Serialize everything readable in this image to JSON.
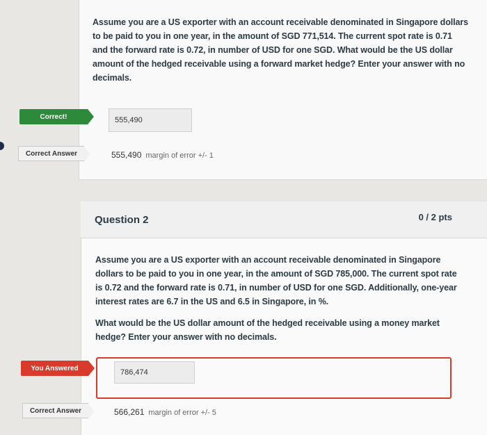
{
  "question1": {
    "text": "Assume you are a US exporter with an account receivable denominated in Singapore dollars to be paid to you in one year, in the amount of SGD 771,514. The current spot rate is 0.71 and the forward rate is 0.72, in number of USD for one SGD. What would be the US dollar amount of the hedged receivable using a forward market hedge? Enter your answer with no decimals.",
    "status_label": "Correct!",
    "your_answer": "555,490",
    "correct_answer_label": "Correct Answer",
    "correct_answer": "555,490",
    "margin": "margin of error +/- 1"
  },
  "question2": {
    "title": "Question 2",
    "points": "0 / 2 pts",
    "text": "Assume you are a US exporter with an account receivable denominated in Singapore dollars to be paid to you in one year, in the amount of SGD 785,000. The current spot rate is 0.72 and the forward rate is 0.71, in number of USD for one SGD. Additionally, one-year interest rates are 6.7 in the US and 6.5 in Singapore, in %.",
    "text2": "What would be the US dollar amount of the hedged receivable using a money market hedge? Enter your answer with no decimals.",
    "status_label": "You Answered",
    "your_answer": "786,474",
    "correct_answer_label": "Correct Answer",
    "correct_answer": "566,261",
    "margin": "margin of error +/- 5"
  },
  "colors": {
    "correct": "#2e8a3b",
    "wrong": "#d83a2b",
    "text": "#2d3b45"
  }
}
